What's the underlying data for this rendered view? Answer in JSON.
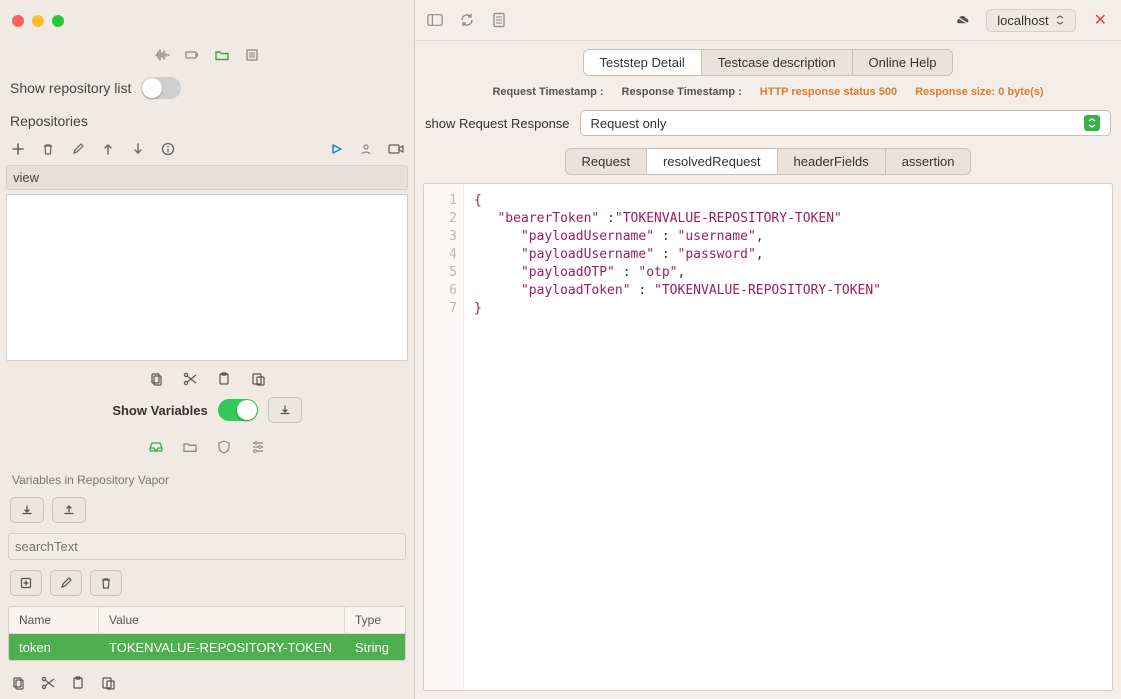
{
  "left": {
    "showRepoLabel": "Show repository list",
    "showRepoOn": false,
    "repositoriesLabel": "Repositories",
    "viewLabel": "view",
    "showVarsLabel": "Show Variables",
    "showVarsOn": true,
    "variablesInLabel": "Variables in  Repository Vapor",
    "searchPlaceholder": "searchText",
    "table": {
      "headers": {
        "name": "Name",
        "value": "Value",
        "type": "Type"
      },
      "row": {
        "name": "token",
        "value": "TOKENVALUE-REPOSITORY-TOKEN",
        "type": "String"
      }
    }
  },
  "right": {
    "host": "localhost",
    "tabs1": [
      "Teststep Detail",
      "Testcase description",
      "Online Help"
    ],
    "tabs1_active": 0,
    "status": {
      "reqTs": "Request Timestamp :",
      "respTs": "Response Timestamp :",
      "http": "HTTP response status 500",
      "size": "Response size: 0 byte(s)"
    },
    "showReqRespLabel": "show Request Response",
    "reqSelValue": "Request only",
    "tabs2": [
      "Request",
      "resolvedRequest",
      "headerFields",
      "assertion"
    ],
    "tabs2_active": 1,
    "code": {
      "lines": [
        "1",
        "2",
        "3",
        "4",
        "5",
        "6",
        "7"
      ],
      "l1": "{",
      "l2_k": "\"bearerToken\"",
      "l2_mid": " :",
      "l2_v": "\"TOKENVALUE-REPOSITORY-TOKEN\"",
      "l3_k": "\"payloadUsername\"",
      "l3_v": "\"username\"",
      "l3_c": ",",
      "l4_k": "\"payloadUsername\"",
      "l4_v": "\"password\"",
      "l4_c": ",",
      "l5_k": "\"payloadOTP\"",
      "l5_v": "\"otp\"",
      "l5_c": ",",
      "l6_k": "\"payloadToken\"",
      "l6_v": "\"TOKENVALUE-REPOSITORY-TOKEN\"",
      "l7": "}"
    }
  }
}
